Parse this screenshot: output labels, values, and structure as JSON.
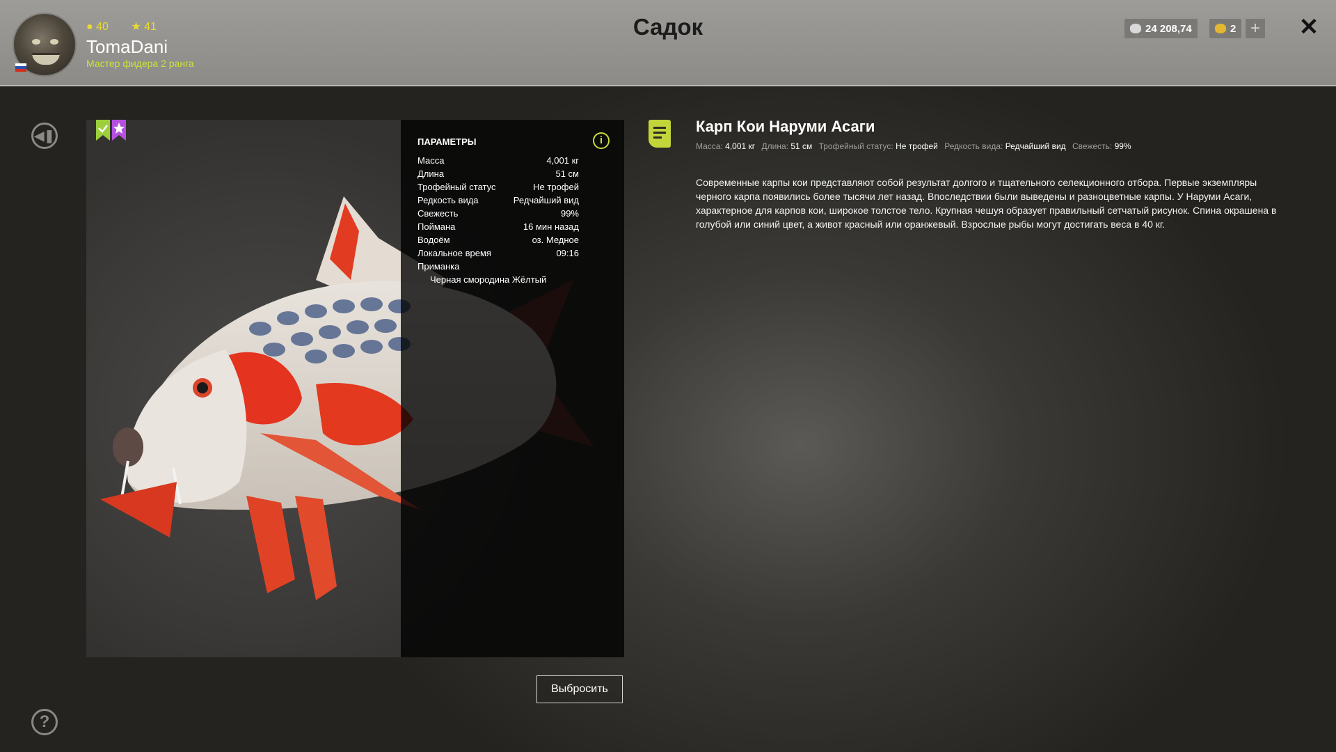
{
  "header": {
    "title": "Садок",
    "player": {
      "level": "40",
      "stars": "41",
      "name": "TomaDani",
      "rank": "Мастер фидера 2 ранга"
    },
    "silver": "24 208,74",
    "gold": "2",
    "plus_label": "+",
    "close_label": "✕"
  },
  "params": {
    "title": "ПАРАМЕТРЫ",
    "info_label": "i",
    "rows": [
      {
        "label": "Масса",
        "value": "4,001 кг"
      },
      {
        "label": "Длина",
        "value": "51 см"
      },
      {
        "label": "Трофейный статус",
        "value": "Не трофей"
      },
      {
        "label": "Редкость вида",
        "value": "Редчайший вид"
      },
      {
        "label": "Свежесть",
        "value": "99%"
      },
      {
        "label": "Поймана",
        "value": "16 мин назад"
      },
      {
        "label": "Водоём",
        "value": "оз. Медное"
      },
      {
        "label": "Локальное время",
        "value": "09:16"
      }
    ],
    "bait_label": "Приманка",
    "bait_value": "Черная смородина Жёлтый"
  },
  "fish": {
    "name": "Карп Кои Наруми Асаги",
    "meta": [
      {
        "label": "Масса:",
        "value": "4,001 кг"
      },
      {
        "label": "Длина:",
        "value": "51 см"
      },
      {
        "label": "Трофейный статус:",
        "value": "Не трофей"
      },
      {
        "label": "Редкость вида:",
        "value": "Редчайший вид"
      },
      {
        "label": "Свежесть:",
        "value": "99%"
      }
    ],
    "description": "Современные карпы кои представляют собой результат долгого и тщательного селекционного отбора. Первые экземпляры черного карпа появились более тысячи лет назад. Впоследствии были выведены и разноцветные карпы. У Наруми Асаги, характерное для карпов кои, широкое толстое тело. Крупная чешуя образует правильный сетчатый рисунок. Спина окрашена в голубой или синий цвет, а живот красный или оранжевый. Взрослые рыбы могут достигать веса в 40 кг."
  },
  "buttons": {
    "discard": "Выбросить",
    "back_icon": "back-icon",
    "help": "?"
  },
  "colors": {
    "accent": "#c9dc3b",
    "level": "#e9da32",
    "badge_green": "#9ccf3c",
    "badge_purple": "#b64fe0"
  }
}
